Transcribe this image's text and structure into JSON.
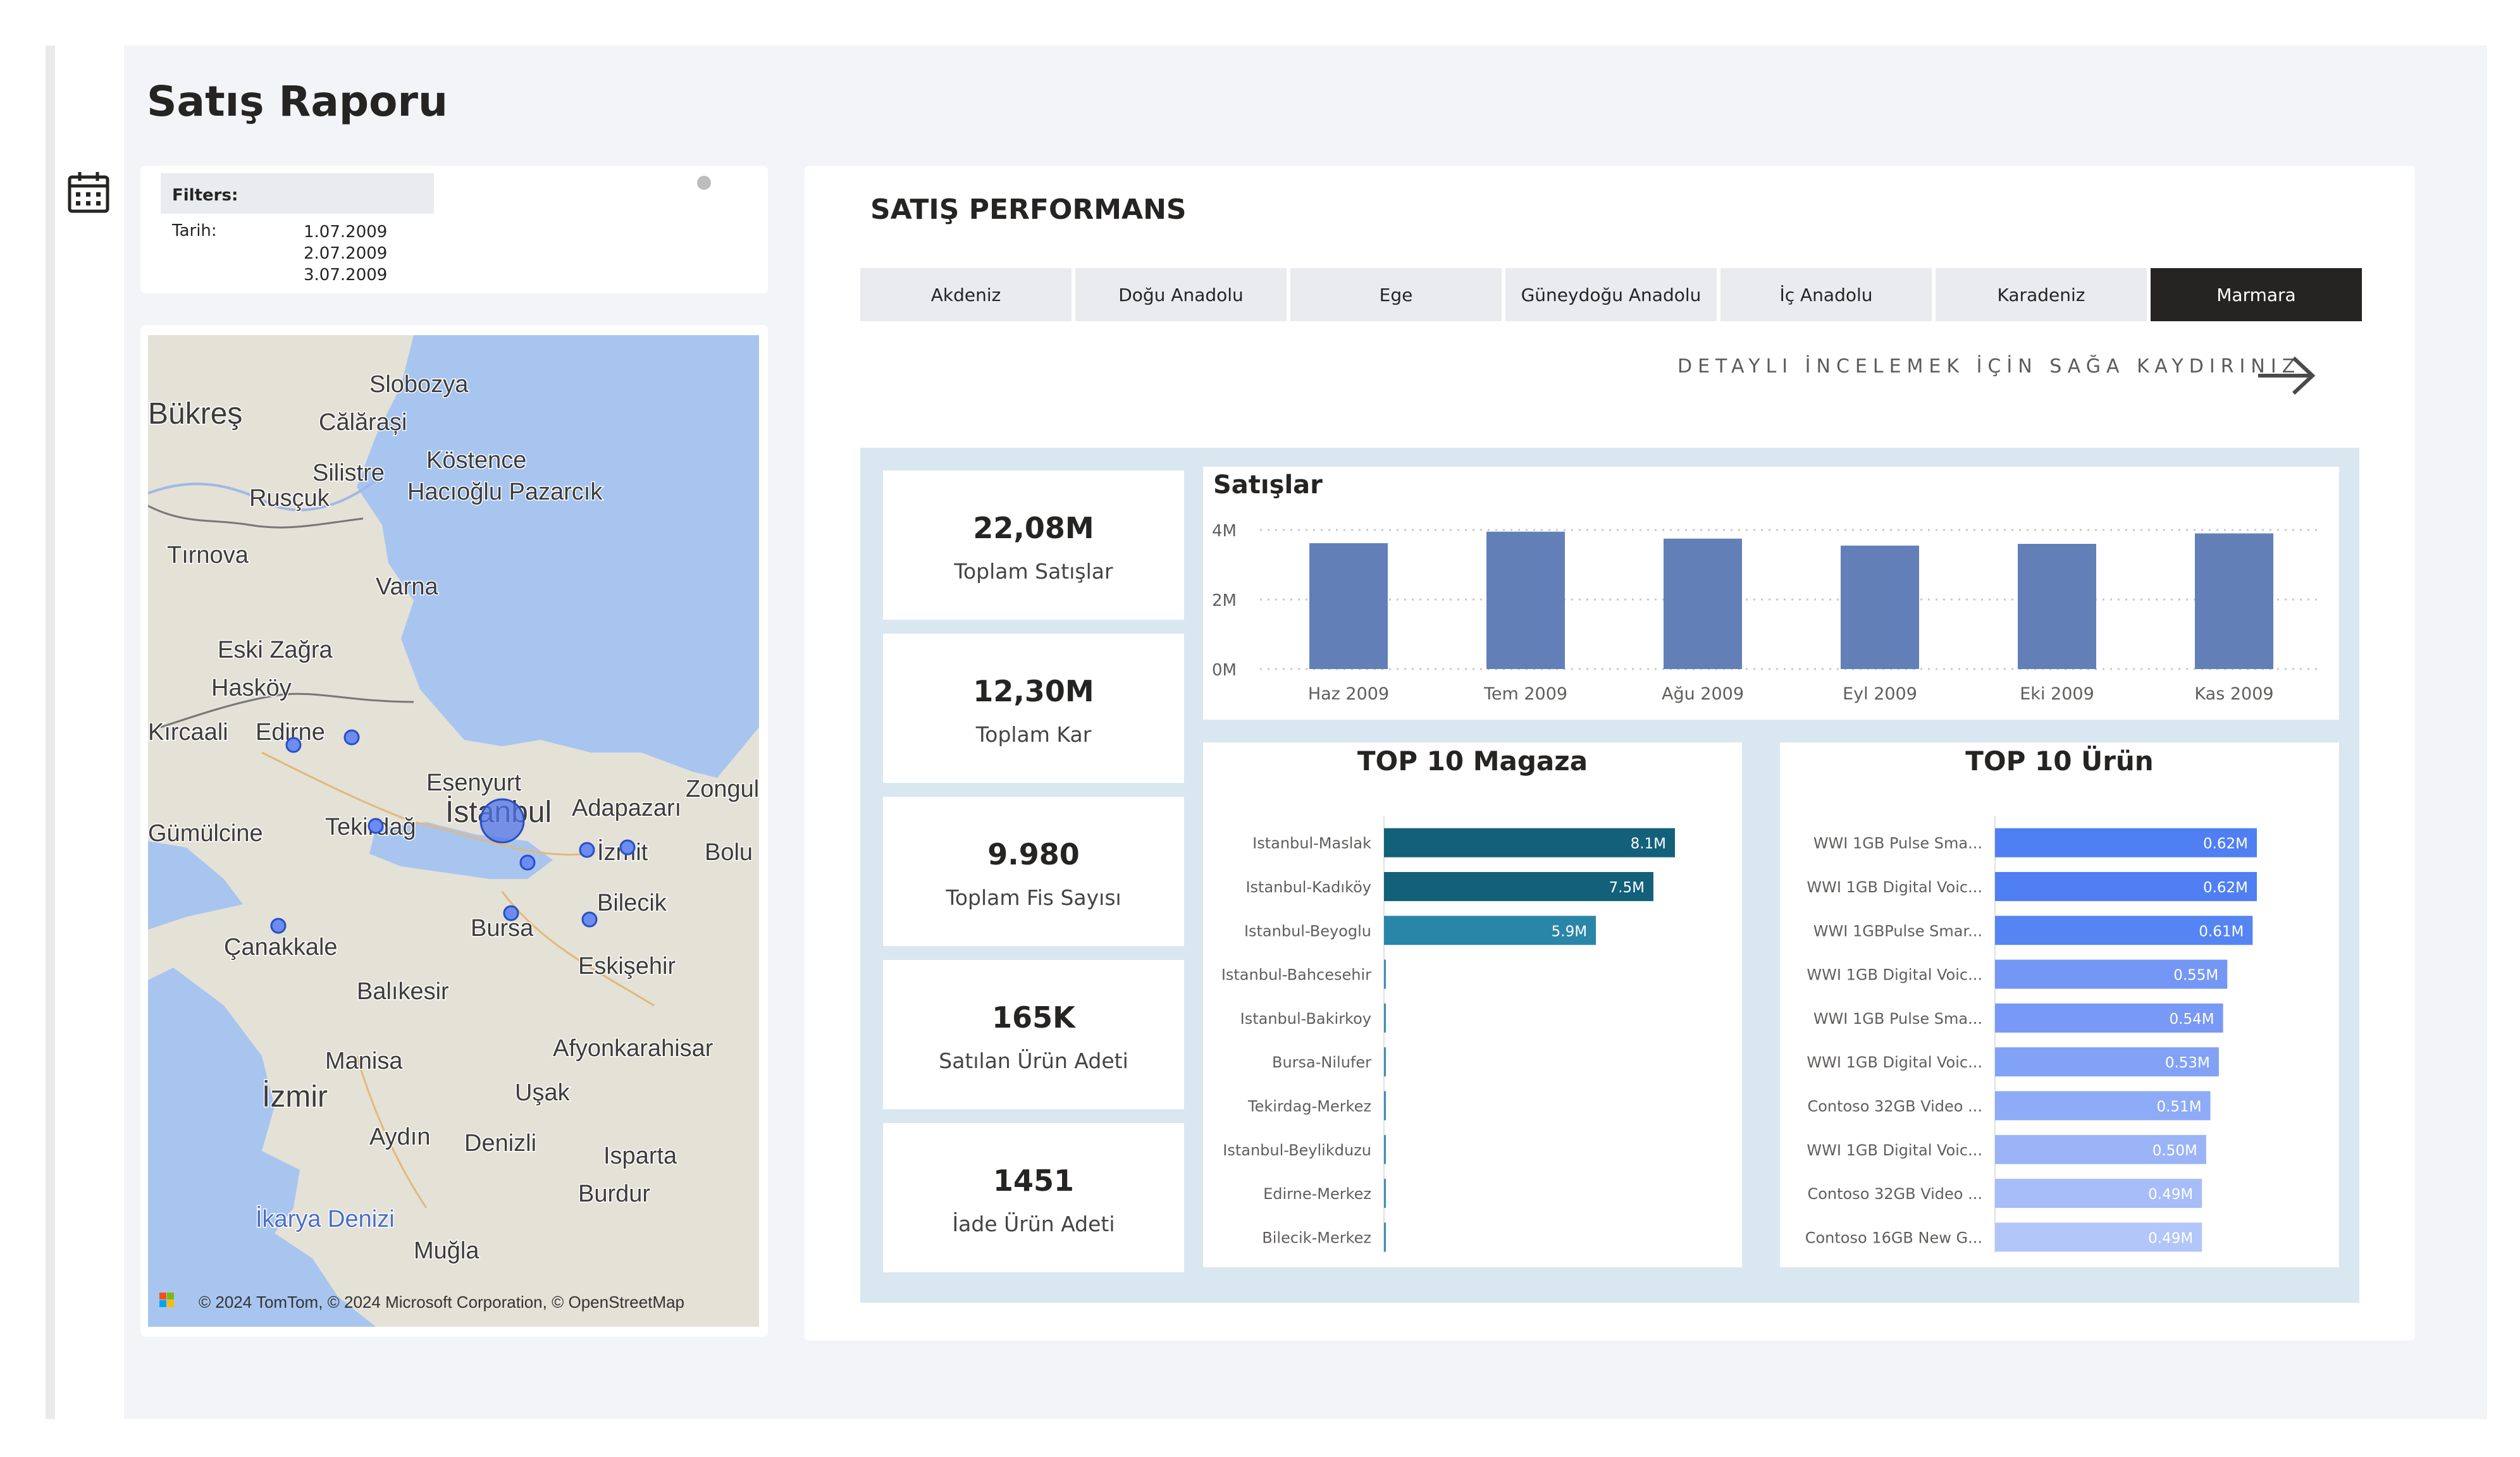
{
  "page": {
    "title": "Satış Raporu"
  },
  "filters": {
    "header": "Filters:",
    "key": "Tarih:",
    "values": [
      "1.07.2009",
      "2.07.2009",
      "3.07.2009"
    ]
  },
  "map": {
    "attribution": "© 2024 TomTom, © 2024 Microsoft Corporation, © OpenStreetMap",
    "labels": [
      "Bükreş",
      "Slobozya",
      "Călărași",
      "Silistre",
      "Köstence",
      "Rusçuk",
      "Hacıoğlu Pazarcık",
      "Tırnova",
      "Varna",
      "Eski Zağra",
      "Hasköy",
      "Kırcaali",
      "Edirne",
      "Esenyurt",
      "İstanbul",
      "Zonguldak",
      "Adapazarı",
      "Tekirdağ",
      "İzmit",
      "Bolu",
      "Gümülcine",
      "Bilecik",
      "Bursa",
      "Çanakkale",
      "Eskişehir",
      "Balıkesir",
      "Afyonkarahisar",
      "Manisa",
      "Uşak",
      "İzmir",
      "Aydın",
      "Denizli",
      "Isparta",
      "Burdur",
      "İkarya Denizi",
      "Muğla"
    ]
  },
  "performance": {
    "title": "SATIŞ PERFORMANS",
    "tabs": [
      "Akdeniz",
      "Doğu Anadolu",
      "Ege",
      "Güneydoğu Anadolu",
      "İç Anadolu",
      "Karadeniz",
      "Marmara"
    ],
    "active_tab": "Marmara",
    "scroll_hint": "DETAYLI İNCELEMEK İÇİN SAĞA KAYDIRINIZ"
  },
  "kpis": [
    {
      "value": "22,08M",
      "label": "Toplam Satışlar"
    },
    {
      "value": "12,30M",
      "label": "Toplam Kar"
    },
    {
      "value": "9.980",
      "label": "Toplam Fis Sayısı"
    },
    {
      "value": "165K",
      "label": "Satılan Ürün Adeti"
    },
    {
      "value": "1451",
      "label": "İade Ürün Adeti"
    }
  ],
  "colors": {
    "bar": "#6280b7",
    "store_bars": [
      "#12607a",
      "#12607a",
      "#2a86a8",
      "#3a8fb3",
      "#3a8fb3",
      "#3a8fb3",
      "#3a8fb3",
      "#3a8fb3",
      "#3a8fb3",
      "#3a8fb3"
    ],
    "product_bars": [
      "#4f7ff3",
      "#4f7ff3",
      "#5584f3",
      "#7497f5",
      "#7899f5",
      "#82a2f6",
      "#8eabf7",
      "#9bb4f8",
      "#a7bdf9",
      "#b2c6fa"
    ]
  },
  "chart_data": [
    {
      "type": "bar",
      "title": "Satışlar",
      "categories": [
        "Haz 2009",
        "Tem 2009",
        "Ağu 2009",
        "Eyl 2009",
        "Eki 2009",
        "Kas 2009"
      ],
      "values": [
        3.62,
        3.95,
        3.75,
        3.55,
        3.6,
        3.9
      ],
      "ylim": [
        0,
        4
      ],
      "yticks": [
        0,
        2,
        4
      ],
      "ytick_labels": [
        "0M",
        "2M",
        "4M"
      ],
      "grid": true
    },
    {
      "type": "bar",
      "orientation": "horizontal",
      "title": "TOP 10 Magaza",
      "categories": [
        "Istanbul-Maslak",
        "Istanbul-Kadıköy",
        "Istanbul-Beyoglu",
        "Istanbul-Bahcesehir",
        "Istanbul-Bakirkoy",
        "Bursa-Nilufer",
        "Tekirdag-Merkez",
        "Istanbul-Beylikduzu",
        "Edirne-Merkez",
        "Bilecik-Merkez"
      ],
      "values": [
        8.1,
        7.5,
        5.9,
        0.03,
        0.03,
        0.03,
        0.03,
        0.03,
        0.03,
        0.03
      ],
      "data_labels": [
        "8.1M",
        "7.5M",
        "5.9M",
        "",
        "",
        "",
        "",
        "",
        "",
        ""
      ],
      "xlim": [
        0,
        8.1
      ]
    },
    {
      "type": "bar",
      "orientation": "horizontal",
      "title": "TOP 10 Ürün",
      "categories": [
        "WWI 1GB Pulse Sma...",
        "WWI 1GB Digital Voic...",
        "WWI 1GBPulse Smar...",
        "WWI 1GB Digital Voic...",
        "WWI 1GB Pulse Sma...",
        "WWI 1GB Digital Voic...",
        "Contoso 32GB Video ...",
        "WWI 1GB Digital Voic...",
        "Contoso 32GB Video ...",
        "Contoso 16GB New G..."
      ],
      "values": [
        0.62,
        0.62,
        0.61,
        0.55,
        0.54,
        0.53,
        0.51,
        0.5,
        0.49,
        0.49
      ],
      "data_labels": [
        "0.62M",
        "0.62M",
        "0.61M",
        "0.55M",
        "0.54M",
        "0.53M",
        "0.51M",
        "0.50M",
        "0.49M",
        "0.49M"
      ],
      "xlim": [
        0,
        0.62
      ]
    }
  ]
}
